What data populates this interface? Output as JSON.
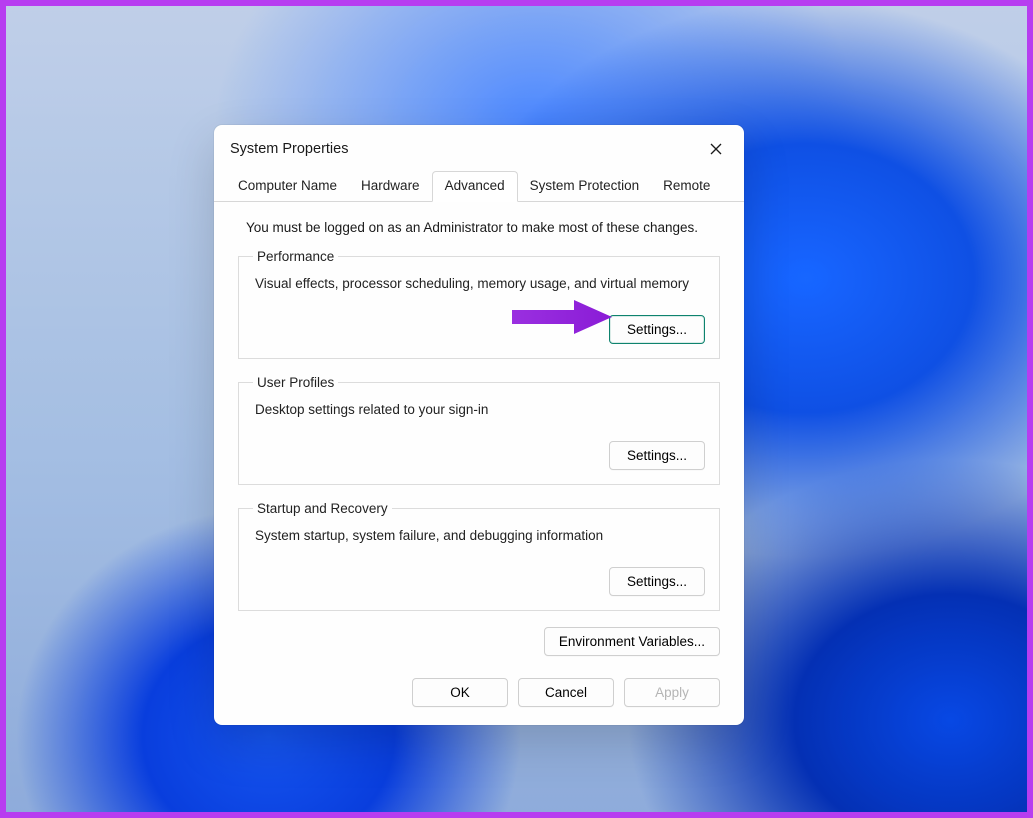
{
  "dialog": {
    "title": "System Properties",
    "tabs": {
      "computer_name": "Computer Name",
      "hardware": "Hardware",
      "advanced": "Advanced",
      "system_protection": "System Protection",
      "remote": "Remote"
    },
    "admin_note": "You must be logged on as an Administrator to make most of these changes.",
    "performance": {
      "legend": "Performance",
      "desc": "Visual effects, processor scheduling, memory usage, and virtual memory",
      "button": "Settings..."
    },
    "user_profiles": {
      "legend": "User Profiles",
      "desc": "Desktop settings related to your sign-in",
      "button": "Settings..."
    },
    "startup": {
      "legend": "Startup and Recovery",
      "desc": "System startup, system failure, and debugging information",
      "button": "Settings..."
    },
    "env_button": "Environment Variables...",
    "footer": {
      "ok": "OK",
      "cancel": "Cancel",
      "apply": "Apply"
    }
  }
}
